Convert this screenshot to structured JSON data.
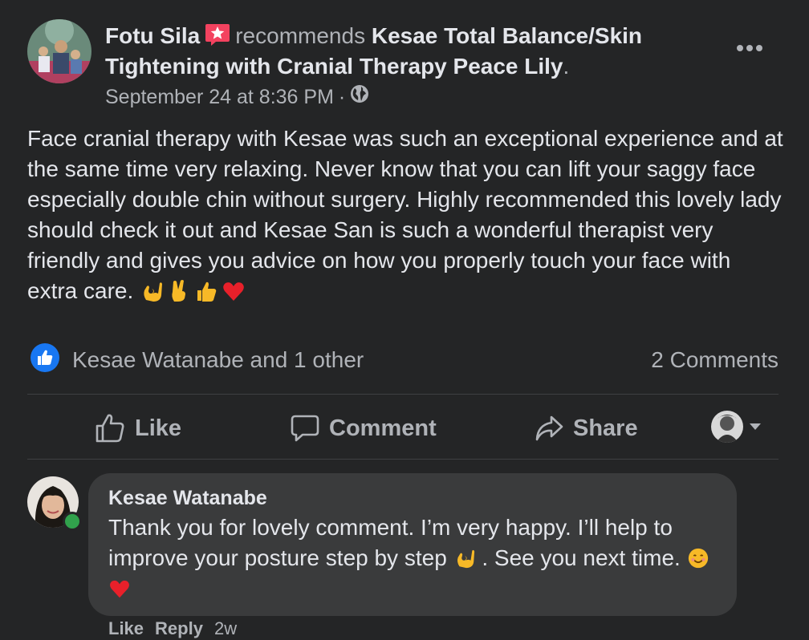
{
  "post": {
    "author": "Fotu Sila",
    "verb": "recommends",
    "page_name": "Kesae Total Balance/Skin Tightening with Cranial Therapy Peace Lily",
    "trailing_punct": ".",
    "timestamp": "September 24 at 8:36 PM",
    "meta_separator": "·",
    "privacy_icon": "globe-icon",
    "body": "Face cranial therapy with Kesae was such an exceptional experience and at the same time very relaxing. Never know that you can lift your saggy face especially double chin without surgery. Highly recommended this lovely lady should check it out and Kesae San is such a wonderful therapist very friendly and gives you advice on how you properly touch your face with extra care.",
    "body_emojis": [
      "ok-hand-emoji",
      "victory-hand-emoji",
      "thumbs-up-emoji",
      "red-heart-emoji"
    ]
  },
  "reactions": {
    "icon": "like-icon",
    "text": "Kesae Watanabe and 1 other",
    "comments_count": "2 Comments"
  },
  "actions": {
    "like": "Like",
    "comment": "Comment",
    "share": "Share"
  },
  "comment": {
    "author": "Kesae Watanabe",
    "text_part1": "Thank you for lovely comment. I’m very happy. I’ll help to improve your posture step by step",
    "text_part2": ". See you next time.",
    "actions": {
      "like": "Like",
      "reply": "Reply",
      "time": "2w"
    }
  },
  "colors": {
    "background": "#242526",
    "bubble": "#3a3b3c",
    "primary_text": "#e4e6eb",
    "secondary_text": "#b0b3b8",
    "accent_blue": "#1877f2",
    "online_green": "#31a24c",
    "badge_pink": "#f3425f"
  }
}
